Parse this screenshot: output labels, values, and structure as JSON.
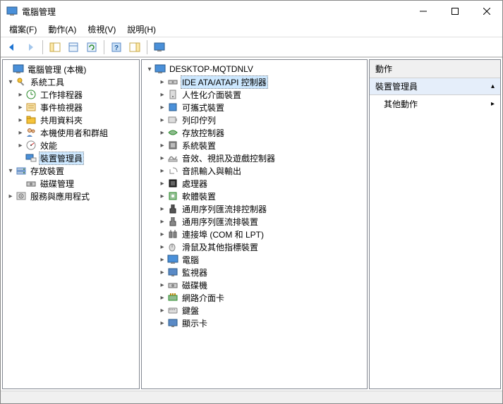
{
  "window": {
    "title": "電腦管理"
  },
  "menu": {
    "file": "檔案(F)",
    "action": "動作(A)",
    "view": "檢視(V)",
    "help": "說明(H)"
  },
  "left": {
    "root": "電腦管理 (本機)",
    "systools": "系統工具",
    "scheduler": "工作排程器",
    "eventviewer": "事件檢視器",
    "sharedfolders": "共用資料夾",
    "localusers": "本機使用者和群組",
    "performance": "效能",
    "devicemanager": "裝置管理員",
    "storage": "存放裝置",
    "diskmgmt": "磁碟管理",
    "services": "服務與應用程式"
  },
  "mid": {
    "computer": "DESKTOP-MQTDNLV",
    "items": [
      "IDE ATA/ATAPI 控制器",
      "人性化介面裝置",
      "可攜式裝置",
      "列印佇列",
      "存放控制器",
      "系統裝置",
      "音效、視訊及遊戲控制器",
      "音訊輸入與輸出",
      "處理器",
      "軟體裝置",
      "通用序列匯流排控制器",
      "通用序列匯流排裝置",
      "連接埠 (COM 和 LPT)",
      "滑鼠及其他指標裝置",
      "電腦",
      "監視器",
      "磁碟機",
      "網路介面卡",
      "鍵盤",
      "顯示卡"
    ]
  },
  "right": {
    "header": "動作",
    "section": "裝置管理員",
    "more": "其他動作"
  }
}
